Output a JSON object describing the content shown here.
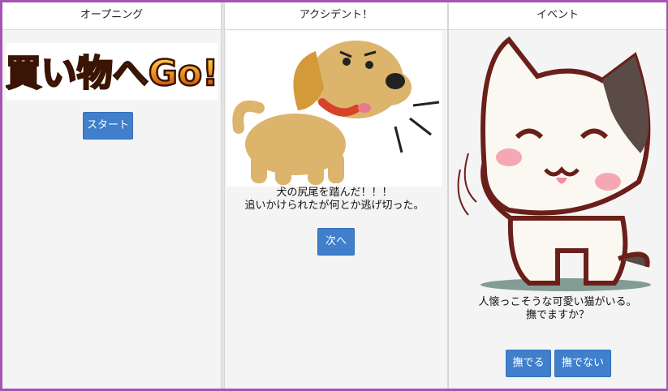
{
  "panels": [
    {
      "title": "オープニング",
      "logo_text": "買い物へGo!",
      "button": "スタート"
    },
    {
      "title": "アクシデント！",
      "message_line1": "犬の尻尾を踏んだ！！！",
      "message_line2": "追いかけられたが何とか逃げ切った。",
      "button": "次へ"
    },
    {
      "title": "イベント",
      "message_line1": "人懐っこそうな可愛い猫がいる。",
      "message_line2": "撫でますか？",
      "button_yes": "撫でる",
      "button_no": "撫でない"
    }
  ],
  "colors": {
    "frame": "#a654b4",
    "button": "#3f7fcc"
  }
}
